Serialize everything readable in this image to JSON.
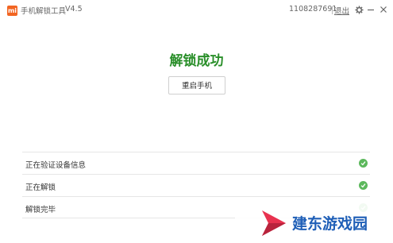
{
  "titlebar": {
    "logo_text": "mi",
    "title": "手机解锁工具",
    "version": "V4.5",
    "account_id": "1108287691",
    "logout_label": "退出"
  },
  "main": {
    "status_title": "解锁成功",
    "restart_button_label": "重启手机"
  },
  "steps": [
    {
      "label": "正在验证设备信息",
      "status": "done"
    },
    {
      "label": "正在解锁",
      "status": "done"
    },
    {
      "label": "解锁完毕",
      "status": "done"
    }
  ],
  "watermark": {
    "text": "建东游戏园"
  },
  "colors": {
    "accent": "#f26522",
    "success": "#2a8f2a",
    "check": "#5cb85c",
    "watermark": "#1f5fb7"
  },
  "icons": [
    "gear-icon",
    "minimize-icon",
    "close-icon",
    "checkmark-icon"
  ]
}
